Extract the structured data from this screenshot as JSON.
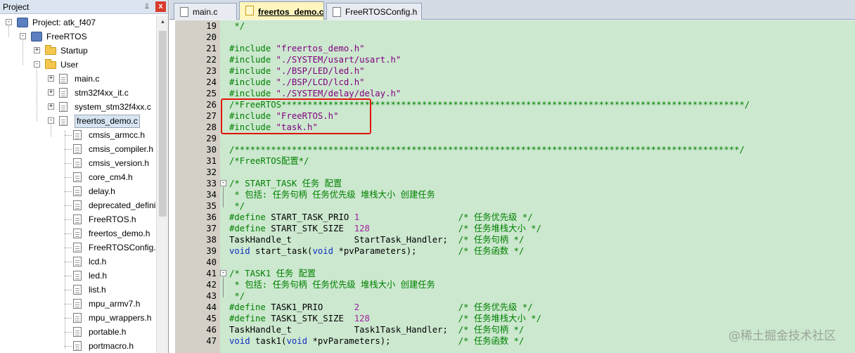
{
  "project_panel": {
    "title": "Project",
    "pin_icon": "📌",
    "close_icon": "x",
    "tree": [
      {
        "id": "project-root",
        "label": "Project: atk_f407",
        "icon": "project-target-icon",
        "expander": "-",
        "level": 0
      },
      {
        "id": "freertos-group",
        "label": "FreeRTOS",
        "icon": "target-icon",
        "expander": "-",
        "level": 1
      },
      {
        "id": "startup-folder",
        "label": "Startup",
        "icon": "folder-icon",
        "expander": "+",
        "level": 2
      },
      {
        "id": "user-folder",
        "label": "User",
        "icon": "folder-open-icon",
        "expander": "-",
        "level": 2
      },
      {
        "id": "main-c",
        "label": "main.c",
        "icon": "file-icon",
        "expander": "+",
        "level": 3
      },
      {
        "id": "stm32f4xx-it-c",
        "label": "stm32f4xx_it.c",
        "icon": "file-icon",
        "expander": "+",
        "level": 3
      },
      {
        "id": "system-stm32f4xx-c",
        "label": "system_stm32f4xx.c",
        "icon": "file-icon",
        "expander": "+",
        "level": 3
      },
      {
        "id": "freertos-demo-c",
        "label": "freertos_demo.c",
        "icon": "file-icon",
        "expander": "-",
        "level": 3,
        "selected": true
      },
      {
        "id": "cmsis-armcc-h",
        "label": "cmsis_armcc.h",
        "icon": "file-icon",
        "level": 4
      },
      {
        "id": "cmsis-compiler-h",
        "label": "cmsis_compiler.h",
        "icon": "file-icon",
        "level": 4
      },
      {
        "id": "cmsis-version-h",
        "label": "cmsis_version.h",
        "icon": "file-icon",
        "level": 4
      },
      {
        "id": "core-cm4-h",
        "label": "core_cm4.h",
        "icon": "file-icon",
        "level": 4
      },
      {
        "id": "delay-h",
        "label": "delay.h",
        "icon": "file-icon",
        "level": 4
      },
      {
        "id": "deprecated-defini",
        "label": "deprecated_defini",
        "icon": "file-icon",
        "level": 4
      },
      {
        "id": "freertos-h",
        "label": "FreeRTOS.h",
        "icon": "file-icon",
        "level": 4
      },
      {
        "id": "freertos-demo-h",
        "label": "freertos_demo.h",
        "icon": "file-icon",
        "level": 4
      },
      {
        "id": "freertosconfig-h",
        "label": "FreeRTOSConfig.h",
        "icon": "file-icon",
        "level": 4
      },
      {
        "id": "lcd-h",
        "label": "lcd.h",
        "icon": "file-icon",
        "level": 4
      },
      {
        "id": "led-h",
        "label": "led.h",
        "icon": "file-icon",
        "level": 4
      },
      {
        "id": "list-h",
        "label": "list.h",
        "icon": "file-icon",
        "level": 4
      },
      {
        "id": "mpu-armv7-h",
        "label": "mpu_armv7.h",
        "icon": "file-icon",
        "level": 4
      },
      {
        "id": "mpu-wrappers-h",
        "label": "mpu_wrappers.h",
        "icon": "file-icon",
        "level": 4
      },
      {
        "id": "portable-h",
        "label": "portable.h",
        "icon": "file-icon",
        "level": 4
      },
      {
        "id": "portmacro-h",
        "label": "portmacro.h",
        "icon": "file-icon",
        "level": 4
      }
    ]
  },
  "tabs": [
    {
      "label": "main.c",
      "active": false
    },
    {
      "label": "freertos_demo.c",
      "active": true
    },
    {
      "label": "FreeRTOSConfig.h",
      "active": false
    }
  ],
  "editor": {
    "lines": [
      {
        "n": "19",
        "segs": [
          {
            "t": " */",
            "c": "cmt"
          }
        ]
      },
      {
        "n": "20",
        "segs": []
      },
      {
        "n": "21",
        "segs": [
          {
            "t": "#include ",
            "c": "green"
          },
          {
            "t": "\"freertos_demo.h\"",
            "c": "str"
          }
        ]
      },
      {
        "n": "22",
        "segs": [
          {
            "t": "#include ",
            "c": "green"
          },
          {
            "t": "\"./SYSTEM/usart/usart.h\"",
            "c": "str"
          }
        ]
      },
      {
        "n": "23",
        "segs": [
          {
            "t": "#include ",
            "c": "green"
          },
          {
            "t": "\"./BSP/LED/led.h\"",
            "c": "str"
          }
        ]
      },
      {
        "n": "24",
        "segs": [
          {
            "t": "#include ",
            "c": "green"
          },
          {
            "t": "\"./BSP/LCD/lcd.h\"",
            "c": "str"
          }
        ]
      },
      {
        "n": "25",
        "segs": [
          {
            "t": "#include ",
            "c": "green"
          },
          {
            "t": "\"./SYSTEM/delay/delay.h\"",
            "c": "str"
          }
        ]
      },
      {
        "n": "26",
        "segs": [
          {
            "t": "/*FreeRTOS*****************************************************************************************/",
            "c": "cmt"
          }
        ]
      },
      {
        "n": "27",
        "segs": [
          {
            "t": "#include ",
            "c": "green"
          },
          {
            "t": "\"FreeRTOS.h\"",
            "c": "str"
          }
        ]
      },
      {
        "n": "28",
        "segs": [
          {
            "t": "#include ",
            "c": "green"
          },
          {
            "t": "\"task.h\"",
            "c": "str"
          }
        ]
      },
      {
        "n": "29",
        "segs": []
      },
      {
        "n": "30",
        "segs": [
          {
            "t": "/*************************************************************************************************/",
            "c": "cmt"
          }
        ]
      },
      {
        "n": "31",
        "segs": [
          {
            "t": "/*FreeRTOS配置*/",
            "c": "cmt"
          }
        ]
      },
      {
        "n": "32",
        "segs": []
      },
      {
        "n": "33",
        "fold": "-",
        "segs": [
          {
            "t": "/* START_TASK 任务 配置",
            "c": "cmt"
          }
        ]
      },
      {
        "n": "34",
        "segs": [
          {
            "t": " * 包括: 任务句柄 任务优先级 堆栈大小 创建任务",
            "c": "cmt"
          }
        ]
      },
      {
        "n": "35",
        "segs": [
          {
            "t": " */",
            "c": "cmt"
          }
        ]
      },
      {
        "n": "36",
        "segs": [
          {
            "t": "#define ",
            "c": "green"
          },
          {
            "t": "START_TASK_PRIO ",
            "c": ""
          },
          {
            "t": "1",
            "c": "num"
          },
          {
            "t": "                   ",
            "c": ""
          },
          {
            "t": "/* 任务优先级 */",
            "c": "cmt"
          }
        ]
      },
      {
        "n": "37",
        "segs": [
          {
            "t": "#define ",
            "c": "green"
          },
          {
            "t": "START_STK_SIZE  ",
            "c": ""
          },
          {
            "t": "128",
            "c": "num"
          },
          {
            "t": "                 ",
            "c": ""
          },
          {
            "t": "/* 任务堆栈大小 */",
            "c": "cmt"
          }
        ]
      },
      {
        "n": "38",
        "segs": [
          {
            "t": "TaskHandle_t            StartTask_Handler;  ",
            "c": ""
          },
          {
            "t": "/* 任务句柄 */",
            "c": "cmt"
          }
        ]
      },
      {
        "n": "39",
        "segs": [
          {
            "t": "void",
            "c": "kw"
          },
          {
            "t": " start_task(",
            "c": ""
          },
          {
            "t": "void",
            "c": "kw"
          },
          {
            "t": " *pvParameters);        ",
            "c": ""
          },
          {
            "t": "/* 任务函数 */",
            "c": "cmt"
          }
        ]
      },
      {
        "n": "40",
        "segs": []
      },
      {
        "n": "41",
        "fold": "-",
        "segs": [
          {
            "t": "/* TASK1 任务 配置",
            "c": "cmt"
          }
        ]
      },
      {
        "n": "42",
        "segs": [
          {
            "t": " * 包括: 任务句柄 任务优先级 堆栈大小 创建任务",
            "c": "cmt"
          }
        ]
      },
      {
        "n": "43",
        "segs": [
          {
            "t": " */",
            "c": "cmt"
          }
        ]
      },
      {
        "n": "44",
        "segs": [
          {
            "t": "#define ",
            "c": "green"
          },
          {
            "t": "TASK1_PRIO      ",
            "c": ""
          },
          {
            "t": "2",
            "c": "num"
          },
          {
            "t": "                   ",
            "c": ""
          },
          {
            "t": "/* 任务优先级 */",
            "c": "cmt"
          }
        ]
      },
      {
        "n": "45",
        "segs": [
          {
            "t": "#define ",
            "c": "green"
          },
          {
            "t": "TASK1_STK_SIZE  ",
            "c": ""
          },
          {
            "t": "128",
            "c": "num"
          },
          {
            "t": "                 ",
            "c": ""
          },
          {
            "t": "/* 任务堆栈大小 */",
            "c": "cmt"
          }
        ]
      },
      {
        "n": "46",
        "segs": [
          {
            "t": "TaskHandle_t            Task1Task_Handler;  ",
            "c": ""
          },
          {
            "t": "/* 任务句柄 */",
            "c": "cmt"
          }
        ]
      },
      {
        "n": "47",
        "segs": [
          {
            "t": "void",
            "c": "kw"
          },
          {
            "t": " task1(",
            "c": ""
          },
          {
            "t": "void",
            "c": "kw"
          },
          {
            "t": " *pvParameters);             ",
            "c": ""
          },
          {
            "t": "/* 任务函数 */",
            "c": "cmt"
          }
        ]
      }
    ]
  },
  "watermark": "@稀土掘金技术社区",
  "colors": {
    "editor_bg": "#cce8cf",
    "highlight_box": "#e3120b",
    "keyword": "#1030c0",
    "string": "#800080",
    "comment": "#008000"
  }
}
